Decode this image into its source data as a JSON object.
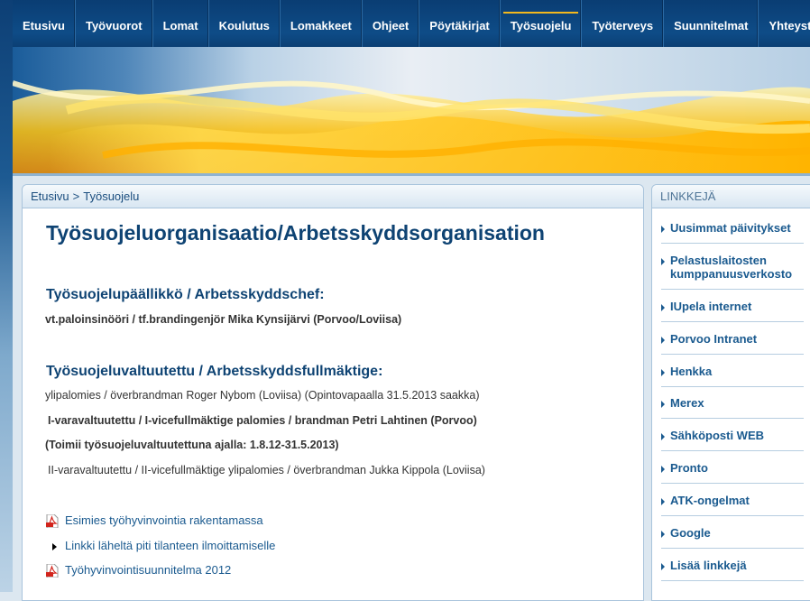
{
  "nav": {
    "items": [
      {
        "label": "Etusivu"
      },
      {
        "label": "Työvuorot"
      },
      {
        "label": "Lomat"
      },
      {
        "label": "Koulutus"
      },
      {
        "label": "Lomakkeet"
      },
      {
        "label": "Ohjeet"
      },
      {
        "label": "Pöytäkirjat"
      },
      {
        "label": "Työsuojelu"
      },
      {
        "label": "Työterveys"
      },
      {
        "label": "Suunnitelmat"
      },
      {
        "label": "Yhteystiedot"
      }
    ],
    "active": "Työsuojelu"
  },
  "breadcrumb": {
    "home": "Etusivu",
    "separator": ">",
    "current": "Työsuojelu"
  },
  "main": {
    "title": "Työsuojeluorganisaatio/Arbetsskyddsorganisation",
    "section1_heading": "Työsuojelupäällikkö / Arbetsskyddschef:",
    "section1_text": "vt.paloinsinööri / tf.brandingenjör Mika Kynsijärvi (Porvoo/Loviisa)",
    "section2_heading": "Työsuojeluvaltuutettu / Arbetsskyddsfullmäktige:",
    "section2_line1": "ylipalomies /  överbrandman Roger Nybom (Loviisa) (Opintovapaalla 31.5.2013 saakka)",
    "section2_line2": "I-varavaltuutettu /  I-vicefullmäktige palomies / brandman Petri Lahtinen (Porvoo)",
    "section2_line3": "(Toimii työsuojeluvaltuutettuna ajalla: 1.8.12-31.5.2013)",
    "section2_line4": "II-varavaltuutettu / II-vicefullmäktige  ylipalomies / överbrandman Jukka Kippola (Loviisa)",
    "links": [
      {
        "label": "Esimies työhyvinvointia rakentamassa",
        "icon": "pdf-icon"
      },
      {
        "label": "Linkki läheltä piti tilanteen ilmoittamiselle",
        "icon": "arrow-icon"
      },
      {
        "label": "Työhyvinvointisuunnitelma 2012",
        "icon": "pdf-icon"
      }
    ]
  },
  "sidebar": {
    "heading": "LINKKEJÄ",
    "items": [
      {
        "label": "Uusimmat päivitykset"
      },
      {
        "label": "Pelastuslaitosten kumppanuusverkosto"
      },
      {
        "label": "IUpela internet"
      },
      {
        "label": "Porvoo Intranet"
      },
      {
        "label": "Henkka"
      },
      {
        "label": "Merex"
      },
      {
        "label": "Sähköposti WEB"
      },
      {
        "label": "Pronto"
      },
      {
        "label": "ATK-ongelmat"
      },
      {
        "label": "Google"
      },
      {
        "label": "Lisää linkkejä"
      }
    ]
  },
  "colors": {
    "nav_bg": "#0e4c87",
    "accent": "#f2b81e",
    "link": "#1a5a8f",
    "heading": "#0e4373"
  }
}
